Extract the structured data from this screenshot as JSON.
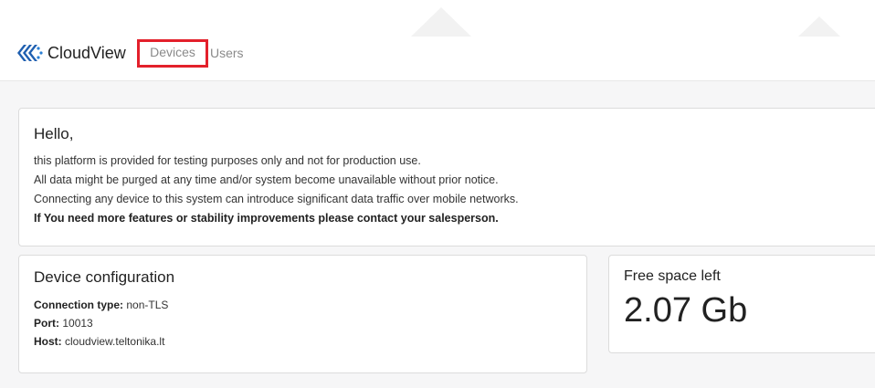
{
  "app": {
    "name": "CloudView"
  },
  "nav": {
    "items": [
      {
        "label": "Devices",
        "highlighted": true
      },
      {
        "label": "Users",
        "highlighted": false
      }
    ]
  },
  "notice": {
    "title": "Hello,",
    "lines": [
      "this platform is provided for testing purposes only and not for production use.",
      "All data might be purged at any time and/or system become unavailable without prior notice.",
      "Connecting any device to this system can introduce significant data traffic over mobile networks."
    ],
    "emphasis": "If You need more features or stability improvements please contact your salesperson."
  },
  "device_config": {
    "title": "Device configuration",
    "connection_type": {
      "label": "Connection type:",
      "value": "non-TLS"
    },
    "port": {
      "label": "Port:",
      "value": "10013"
    },
    "host": {
      "label": "Host:",
      "value": "cloudview.teltonika.lt"
    }
  },
  "free_space": {
    "title": "Free space left",
    "value": "2.07 Gb"
  },
  "colors": {
    "highlight_border": "#e3202b",
    "brand_blue": "#1f5fb0",
    "content_bg": "#f6f6f7"
  }
}
